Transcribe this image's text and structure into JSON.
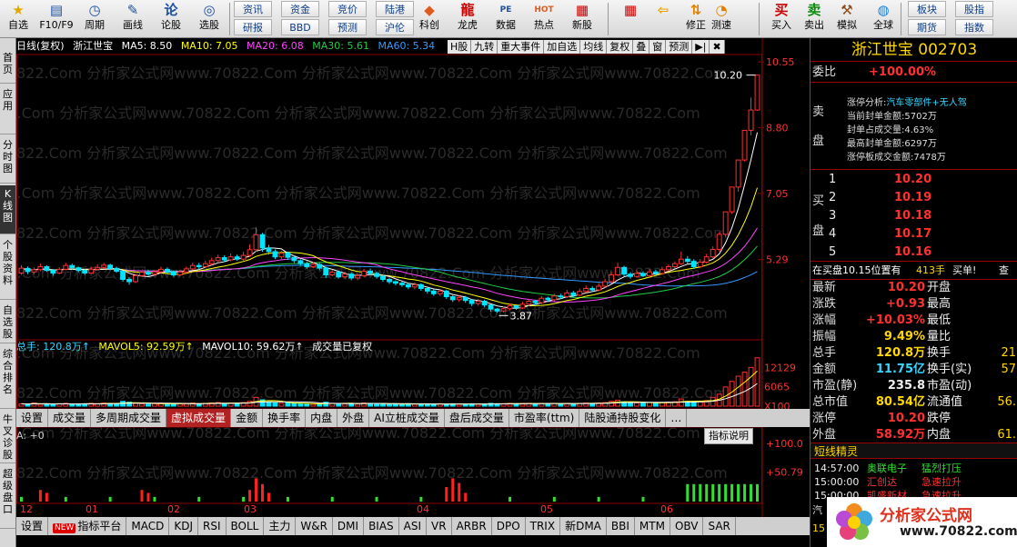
{
  "toolbar": {
    "buttons": [
      {
        "label": "自选",
        "icon": "★"
      },
      {
        "label": "F10/F9",
        "icon": "▤"
      },
      {
        "label": "周期",
        "icon": "◷"
      },
      {
        "label": "画线",
        "icon": "✎"
      },
      {
        "label": "论股",
        "icon": "论"
      },
      {
        "label": "选股",
        "icon": "◎"
      },
      {
        "label": "科创",
        "icon": "◆"
      },
      {
        "label": "龙虎",
        "icon": "龍"
      },
      {
        "label": "数据",
        "icon": "PE"
      },
      {
        "label": "热点",
        "icon": "HOT"
      },
      {
        "label": "新股",
        "icon": "▦"
      },
      {
        "label": "",
        "icon": "▦"
      },
      {
        "label": "",
        "icon": "⇦"
      },
      {
        "label": "修正",
        "icon": "⇅"
      },
      {
        "label": "测速",
        "icon": "◔"
      },
      {
        "label": "买入",
        "icon": "买"
      },
      {
        "label": "卖出",
        "icon": "卖"
      },
      {
        "label": "模拟",
        "icon": "⚒"
      },
      {
        "label": "全球",
        "icon": "◍"
      }
    ],
    "small_top": [
      "资讯",
      "资金",
      "竞价",
      "陆港"
    ],
    "small_bottom": [
      "研报",
      "BBD",
      "预测",
      "沪伦"
    ],
    "right_top": [
      "板块",
      "股指"
    ],
    "right_bottom": [
      "期货",
      "指数"
    ]
  },
  "left_tabs": [
    "首页",
    "应用",
    "分时图",
    "K线图",
    "个股资料",
    "自选股",
    "综合排名",
    "牛叉诊股",
    "超级盘口"
  ],
  "info": {
    "period": "日线(复权)",
    "name": "浙江世宝",
    "ma5": "MA5: 8.50",
    "ma10": "MA10: 7.05",
    "ma20": "MA20: 6.08",
    "ma30": "MA30: 5.61",
    "ma60": "MA60: 5.34"
  },
  "top_menu": [
    "H股",
    "九转",
    "重大事件",
    "加自选",
    "均线",
    "复权",
    "叠",
    "窗",
    "预测",
    "▶|",
    "✖"
  ],
  "watermark": "822.Com 分析家公式网www.70822.Com 分析家公式网www.70822.Com 分析家公式网www.70822.Com",
  "price_axis": [
    "10.55",
    "8.80",
    "7.05",
    "5.29"
  ],
  "price_annotations": {
    "high": "10.20",
    "low": "3.87"
  },
  "volume_info": {
    "total": "总手: 120.8万↑",
    "mavol5": "MAVOL5: 92.59万↑",
    "mavol10": "MAVOL10: 59.62万↑",
    "note": "成交量已复权"
  },
  "volume_axis": [
    "12129",
    "6065",
    "X100"
  ],
  "tabs1": [
    "设置",
    "成交量",
    "多周期成交量",
    "虚拟成交量",
    "金额",
    "换手率",
    "内盘",
    "外盘",
    "AI立桩成交量",
    "盘后成交量",
    "市盈率(ttm)",
    "陆股通持股变化",
    "…"
  ],
  "tabs1_active": 3,
  "indicator_label": "A: +0",
  "indicator_explain": "指标说明",
  "indicator_axis": [
    "+100.0",
    "+50.79"
  ],
  "month_labels": [
    "12",
    "01",
    "02",
    "03",
    "04",
    "05",
    "06"
  ],
  "tabs2_new": "NEW",
  "tabs2": [
    "设置",
    "指标平台",
    "MACD",
    "KDJ",
    "RSI",
    "BOLL",
    "主力",
    "W&R",
    "DMI",
    "BIAS",
    "ASI",
    "VR",
    "ARBR",
    "DPO",
    "TRIX",
    "新DMA",
    "BBI",
    "MTM",
    "OBV",
    "SAR"
  ],
  "right": {
    "title": "浙江世宝  002703",
    "weibi_label": "委比",
    "weibi_value": "+100.00%",
    "sell_label1": "卖",
    "sell_label2": "盘",
    "limit_title": "涨停分析:",
    "limit_sector": "汽车零部件+无人驾",
    "limit_lines": [
      "当前封单金额:5702万",
      "封单占成交量:4.63%",
      "最高封单金额:6297万",
      "涨停板成交金额:7478万"
    ],
    "buy_label1": "买",
    "buy_label2": "盘",
    "buy_levels": [
      {
        "n": "1",
        "price": "10.20"
      },
      {
        "n": "2",
        "price": "10.19"
      },
      {
        "n": "3",
        "price": "10.18"
      },
      {
        "n": "4",
        "price": "10.17"
      },
      {
        "n": "5",
        "price": "10.16"
      }
    ],
    "position_text": "在买盘10.15位置有",
    "position_vol": "413手",
    "position_act": "买单!",
    "position_more": "查",
    "stats": [
      {
        "l": "最新",
        "v": "10.20",
        "c": "red",
        "l2": "开盘",
        "v2": ""
      },
      {
        "l": "涨跌",
        "v": "+0.93",
        "c": "red",
        "l2": "最高",
        "v2": ""
      },
      {
        "l": "涨幅",
        "v": "+10.03%",
        "c": "red",
        "l2": "最低",
        "v2": ""
      },
      {
        "l": "振幅",
        "v": "9.49%",
        "c": "yel",
        "l2": "量比",
        "v2": ""
      },
      {
        "l": "总手",
        "v": "120.8万",
        "c": "yel",
        "l2": "换手",
        "v2": "21"
      },
      {
        "l": "金额",
        "v": "11.75亿",
        "c": "cyan",
        "l2": "换手(实)",
        "v2": "57"
      },
      {
        "l": "市盈(静)",
        "v": "235.8",
        "c": "white",
        "l2": "市盈(动)",
        "v2": ""
      },
      {
        "l": "总市值",
        "v": "80.54亿",
        "c": "yel",
        "l2": "流通值",
        "v2": "56."
      },
      {
        "l": "涨停",
        "v": "10.20",
        "c": "red",
        "l2": "跌停",
        "v2": ""
      },
      {
        "l": "外盘",
        "v": "58.92万",
        "c": "red",
        "l2": "内盘",
        "v2": "61."
      }
    ],
    "short_title": "短线精灵",
    "short_rows": [
      {
        "time": "14:57:00",
        "name": "奥联电子",
        "event": "猛烈打压",
        "c": "green"
      },
      {
        "time": "15:00:00",
        "name": "汇创达",
        "event": "急速拉升",
        "c": "red"
      },
      {
        "time": "15:00:00",
        "name": "凯盛新材",
        "event": "急速拉升",
        "c": "red"
      }
    ],
    "bottom_partial": [
      "汽",
      "15"
    ],
    "logo_text": "分析家公式网",
    "logo_url": "www.70822.com"
  },
  "chart_data": {
    "type": "candlestick",
    "ma_colors": {
      "ma5": "#ffffff",
      "ma10": "#ffff00",
      "ma20": "#ff44ff",
      "ma30": "#22cc44",
      "ma60": "#3399ff"
    },
    "up_color": "#ff3030",
    "down_color": "#00e5ff",
    "price_ylim": [
      3.2,
      10.7
    ],
    "candles": [
      [
        4.93,
        5.06,
        5.14,
        4.88
      ],
      [
        5.05,
        4.97,
        5.1,
        4.9
      ],
      [
        4.96,
        5.02,
        5.08,
        4.9
      ],
      [
        5.02,
        5.1,
        5.18,
        4.98
      ],
      [
        5.1,
        5.0,
        5.14,
        4.96
      ],
      [
        5.0,
        4.93,
        5.04,
        4.86
      ],
      [
        4.93,
        5.03,
        5.08,
        4.9
      ],
      [
        5.03,
        5.13,
        5.2,
        5.0
      ],
      [
        5.13,
        5.07,
        5.18,
        5.02
      ],
      [
        5.07,
        5.0,
        5.1,
        4.95
      ],
      [
        5.0,
        4.93,
        5.04,
        4.88
      ],
      [
        4.93,
        5.03,
        5.1,
        4.9
      ],
      [
        5.03,
        5.08,
        5.16,
        5.0
      ],
      [
        5.08,
        5.14,
        5.2,
        5.04
      ],
      [
        5.14,
        5.05,
        5.18,
        5.0
      ],
      [
        5.05,
        4.98,
        5.1,
        4.94
      ],
      [
        4.98,
        4.76,
        5.0,
        4.7
      ],
      [
        4.76,
        4.7,
        4.82,
        4.62
      ],
      [
        4.7,
        4.86,
        4.92,
        4.66
      ],
      [
        4.86,
        4.95,
        5.0,
        4.82
      ],
      [
        4.95,
        4.9,
        5.02,
        4.86
      ],
      [
        4.9,
        4.96,
        5.02,
        4.86
      ],
      [
        4.96,
        5.03,
        5.1,
        4.92
      ],
      [
        5.03,
        4.96,
        5.08,
        4.92
      ],
      [
        4.96,
        4.88,
        5.0,
        4.84
      ],
      [
        4.88,
        4.96,
        5.02,
        4.84
      ],
      [
        4.96,
        5.04,
        5.1,
        4.92
      ],
      [
        5.04,
        5.13,
        5.2,
        5.0
      ],
      [
        5.13,
        5.1,
        5.2,
        5.04
      ],
      [
        5.1,
        5.18,
        5.26,
        5.06
      ],
      [
        5.18,
        5.26,
        5.34,
        5.14
      ],
      [
        5.26,
        5.34,
        5.42,
        5.2
      ],
      [
        5.34,
        5.28,
        5.4,
        5.22
      ],
      [
        5.28,
        5.36,
        5.45,
        5.24
      ],
      [
        5.36,
        5.3,
        5.42,
        5.26
      ],
      [
        5.3,
        5.4,
        5.5,
        5.26
      ],
      [
        5.4,
        5.55,
        5.7,
        5.36
      ],
      [
        5.55,
        5.95,
        6.15,
        5.5
      ],
      [
        5.95,
        5.6,
        6.0,
        5.5
      ],
      [
        5.6,
        5.5,
        5.68,
        5.42
      ],
      [
        5.5,
        5.36,
        5.56,
        5.3
      ],
      [
        5.36,
        5.46,
        5.52,
        5.3
      ],
      [
        5.46,
        5.35,
        5.5,
        5.28
      ],
      [
        5.35,
        5.26,
        5.4,
        5.2
      ],
      [
        5.26,
        5.18,
        5.3,
        5.12
      ],
      [
        5.18,
        5.1,
        5.24,
        5.04
      ],
      [
        5.1,
        5.16,
        5.22,
        5.06
      ],
      [
        5.16,
        5.06,
        5.2,
        5.0
      ],
      [
        5.06,
        4.88,
        5.1,
        4.8
      ],
      [
        4.88,
        4.95,
        5.02,
        4.84
      ],
      [
        4.95,
        4.83,
        5.0,
        4.78
      ],
      [
        4.83,
        4.9,
        4.96,
        4.78
      ],
      [
        4.9,
        4.8,
        4.95,
        4.74
      ],
      [
        4.8,
        4.86,
        4.92,
        4.74
      ],
      [
        4.86,
        4.98,
        5.04,
        4.82
      ],
      [
        4.98,
        4.92,
        5.05,
        4.88
      ],
      [
        4.92,
        4.84,
        4.97,
        4.78
      ],
      [
        4.84,
        4.76,
        4.88,
        4.7
      ],
      [
        4.76,
        4.7,
        4.8,
        4.64
      ],
      [
        4.7,
        4.66,
        4.74,
        4.6
      ],
      [
        4.66,
        4.62,
        4.7,
        4.56
      ],
      [
        4.62,
        4.56,
        4.66,
        4.5
      ],
      [
        4.56,
        4.62,
        4.68,
        4.5
      ],
      [
        4.62,
        4.52,
        4.66,
        4.46
      ],
      [
        4.52,
        4.45,
        4.56,
        4.38
      ],
      [
        4.45,
        4.38,
        4.5,
        4.32
      ],
      [
        4.38,
        4.45,
        4.5,
        4.32
      ],
      [
        4.45,
        4.3,
        4.48,
        4.24
      ],
      [
        4.3,
        4.22,
        4.34,
        4.16
      ],
      [
        4.22,
        4.28,
        4.34,
        4.16
      ],
      [
        4.28,
        4.2,
        4.32,
        4.14
      ],
      [
        4.2,
        4.12,
        4.24,
        4.05
      ],
      [
        4.12,
        4.18,
        4.24,
        4.06
      ],
      [
        4.18,
        4.08,
        4.22,
        4.02
      ],
      [
        4.08,
        3.97,
        4.1,
        3.9
      ],
      [
        3.97,
        3.92,
        4.0,
        3.87
      ],
      [
        3.92,
        3.98,
        4.04,
        3.88
      ],
      [
        3.98,
        4.06,
        4.12,
        3.94
      ],
      [
        4.06,
        4.0,
        4.1,
        3.95
      ],
      [
        4.0,
        4.1,
        4.16,
        3.97
      ],
      [
        4.1,
        4.18,
        4.24,
        4.05
      ],
      [
        4.18,
        4.14,
        4.22,
        4.08
      ],
      [
        4.14,
        4.26,
        4.32,
        4.1
      ],
      [
        4.26,
        4.22,
        4.3,
        4.16
      ],
      [
        4.22,
        4.32,
        4.38,
        4.18
      ],
      [
        4.32,
        4.3,
        4.38,
        4.24
      ],
      [
        4.3,
        4.4,
        4.48,
        4.26
      ],
      [
        4.4,
        4.34,
        4.46,
        4.28
      ],
      [
        4.34,
        4.44,
        4.52,
        4.3
      ],
      [
        4.44,
        4.52,
        4.6,
        4.4
      ],
      [
        4.52,
        4.48,
        4.58,
        4.42
      ],
      [
        4.48,
        4.58,
        4.66,
        4.44
      ],
      [
        4.58,
        4.7,
        4.78,
        4.54
      ],
      [
        4.7,
        4.88,
        4.96,
        4.66
      ],
      [
        4.88,
        5.08,
        5.2,
        4.84
      ],
      [
        5.08,
        4.9,
        5.12,
        4.84
      ],
      [
        4.9,
        4.84,
        4.96,
        4.78
      ],
      [
        4.84,
        4.92,
        5.0,
        4.8
      ],
      [
        4.92,
        4.86,
        4.98,
        4.82
      ],
      [
        4.86,
        4.96,
        5.04,
        4.82
      ],
      [
        4.96,
        4.92,
        5.02,
        4.88
      ],
      [
        4.92,
        5.02,
        5.1,
        4.88
      ],
      [
        5.02,
        5.1,
        5.16,
        4.98
      ],
      [
        5.1,
        5.18,
        5.24,
        5.06
      ],
      [
        5.18,
        5.3,
        5.5,
        5.14
      ],
      [
        5.3,
        5.24,
        5.38,
        5.18
      ],
      [
        5.24,
        5.1,
        5.3,
        5.04
      ],
      [
        5.1,
        5.22,
        5.3,
        5.06
      ],
      [
        5.22,
        5.36,
        5.44,
        5.18
      ],
      [
        5.36,
        5.56,
        5.64,
        5.3
      ],
      [
        5.56,
        5.96,
        6.02,
        5.5
      ],
      [
        5.96,
        6.56,
        6.56,
        5.9
      ],
      [
        6.56,
        7.22,
        7.22,
        6.5
      ],
      [
        7.22,
        7.94,
        7.94,
        7.1
      ],
      [
        7.94,
        8.73,
        8.73,
        7.9
      ],
      [
        8.73,
        9.27,
        9.6,
        8.6
      ],
      [
        9.27,
        10.2,
        10.2,
        9.25
      ]
    ],
    "volume": [
      6,
      5,
      8,
      5,
      6,
      4,
      6,
      7,
      5,
      5,
      6,
      7,
      6,
      8,
      7,
      6,
      12,
      10,
      7,
      6,
      5,
      6,
      8,
      6,
      5,
      6,
      7,
      8,
      6,
      7,
      8,
      9,
      7,
      8,
      7,
      9,
      12,
      22,
      16,
      10,
      8,
      7,
      8,
      7,
      6,
      6,
      5,
      6,
      10,
      7,
      6,
      6,
      7,
      6,
      8,
      7,
      6,
      5,
      5,
      6,
      5,
      6,
      5,
      5,
      6,
      5,
      6,
      5,
      6,
      5,
      5,
      6,
      5,
      5,
      7,
      6,
      6,
      7,
      6,
      7,
      7,
      6,
      7,
      6,
      7,
      6,
      7,
      6,
      7,
      8,
      7,
      8,
      9,
      12,
      15,
      11,
      9,
      8,
      8,
      9,
      8,
      9,
      10,
      11,
      18,
      12,
      10,
      11,
      14,
      22,
      30,
      48,
      62,
      75,
      85,
      97,
      121
    ],
    "volume_ylim": [
      0,
      125
    ],
    "indicator": [
      0,
      0,
      0,
      20,
      15,
      0,
      0,
      0,
      0,
      0,
      0,
      0,
      0,
      0,
      0,
      0,
      0,
      0,
      0,
      20,
      15,
      0,
      0,
      0,
      0,
      0,
      0,
      0,
      0,
      0,
      0,
      0,
      0,
      0,
      0,
      0,
      20,
      40,
      30,
      15,
      0,
      0,
      0,
      0,
      0,
      0,
      0,
      0,
      0,
      0,
      0,
      0,
      0,
      0,
      0,
      0,
      0,
      0,
      0,
      0,
      0,
      0,
      0,
      0,
      0,
      0,
      0,
      25,
      40,
      32,
      15,
      0,
      0,
      0,
      0,
      0,
      0,
      0,
      0,
      0,
      0,
      0,
      0,
      0,
      0,
      0,
      0,
      0,
      0,
      0,
      0,
      0,
      0,
      0,
      0,
      0,
      0,
      0,
      0,
      0,
      0,
      0,
      0,
      0,
      0,
      0,
      0,
      0,
      0,
      0,
      0,
      0,
      0,
      0,
      0,
      0,
      0
    ],
    "indicator_ylim": [
      0,
      100
    ]
  }
}
